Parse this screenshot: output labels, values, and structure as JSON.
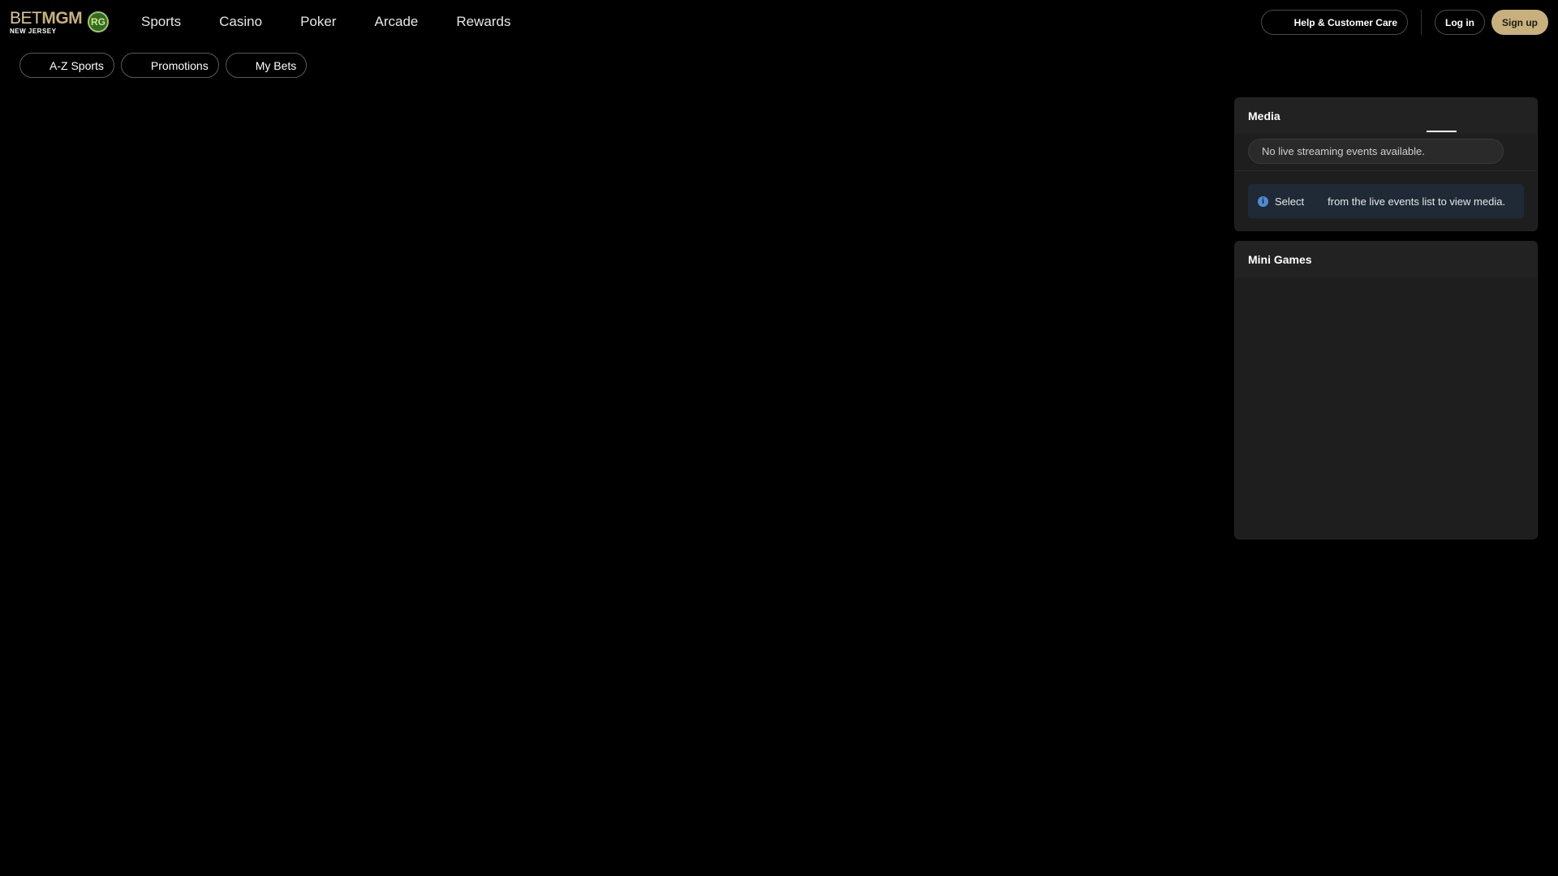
{
  "brand": {
    "wordmark_bet": "BET",
    "wordmark_mgm": "MGM",
    "region": "NEW JERSEY",
    "rg_badge": "RG",
    "accent_gold": "#c8b07c"
  },
  "main_nav": {
    "items": [
      {
        "label": "Sports"
      },
      {
        "label": "Casino"
      },
      {
        "label": "Poker"
      },
      {
        "label": "Arcade"
      },
      {
        "label": "Rewards"
      }
    ]
  },
  "header": {
    "help_label": "Help & Customer Care",
    "help_icon": "help-icon",
    "login_label": "Log in",
    "signup_label": "Sign up"
  },
  "subnav": {
    "items": [
      {
        "label": "A-Z Sports",
        "icon": "list-icon"
      },
      {
        "label": "Promotions",
        "icon": "gift-icon"
      },
      {
        "label": "My Bets",
        "icon": "ticket-icon"
      }
    ]
  },
  "media": {
    "title": "Media",
    "stream_select_text": "No live streaming events available.",
    "info_select": "Select",
    "info_text": "from the live events list to view media.",
    "info_icon": "info-icon"
  },
  "mini_games": {
    "title": "Mini Games"
  }
}
